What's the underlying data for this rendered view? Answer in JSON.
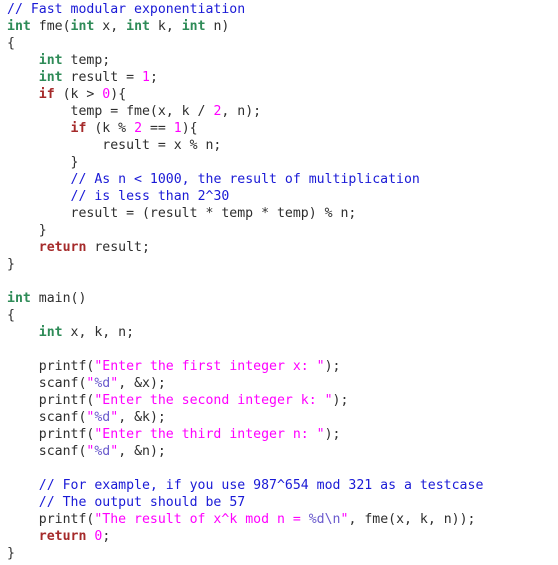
{
  "editor": {
    "language": "C",
    "colors": {
      "comment": "#1a1ad6",
      "type": "#2e8b57",
      "keyword": "#a52a2a",
      "number": "#ff00ff",
      "string": "#ff00ff",
      "specifier": "#6a5acd",
      "text": "#2e2e2e",
      "background": "#ffffff"
    },
    "lines": [
      [
        {
          "t": "cm",
          "v": "// Fast modular exponentiation"
        }
      ],
      [
        {
          "t": "ty",
          "v": "int"
        },
        {
          "t": "tx",
          "v": " fme("
        },
        {
          "t": "ty",
          "v": "int"
        },
        {
          "t": "tx",
          "v": " x, "
        },
        {
          "t": "ty",
          "v": "int"
        },
        {
          "t": "tx",
          "v": " k, "
        },
        {
          "t": "ty",
          "v": "int"
        },
        {
          "t": "tx",
          "v": " n)"
        }
      ],
      [
        {
          "t": "tx",
          "v": "{"
        }
      ],
      [
        {
          "t": "tx",
          "v": "    "
        },
        {
          "t": "ty",
          "v": "int"
        },
        {
          "t": "tx",
          "v": " temp;"
        }
      ],
      [
        {
          "t": "tx",
          "v": "    "
        },
        {
          "t": "ty",
          "v": "int"
        },
        {
          "t": "tx",
          "v": " result = "
        },
        {
          "t": "nu",
          "v": "1"
        },
        {
          "t": "tx",
          "v": ";"
        }
      ],
      [
        {
          "t": "tx",
          "v": "    "
        },
        {
          "t": "kw",
          "v": "if"
        },
        {
          "t": "tx",
          "v": " (k > "
        },
        {
          "t": "nu",
          "v": "0"
        },
        {
          "t": "tx",
          "v": "){"
        }
      ],
      [
        {
          "t": "tx",
          "v": "        temp = fme(x, k / "
        },
        {
          "t": "nu",
          "v": "2"
        },
        {
          "t": "tx",
          "v": ", n);"
        }
      ],
      [
        {
          "t": "tx",
          "v": "        "
        },
        {
          "t": "kw",
          "v": "if"
        },
        {
          "t": "tx",
          "v": " (k % "
        },
        {
          "t": "nu",
          "v": "2"
        },
        {
          "t": "tx",
          "v": " == "
        },
        {
          "t": "nu",
          "v": "1"
        },
        {
          "t": "tx",
          "v": "){"
        }
      ],
      [
        {
          "t": "tx",
          "v": "            result = x % n;"
        }
      ],
      [
        {
          "t": "tx",
          "v": "        }"
        }
      ],
      [
        {
          "t": "tx",
          "v": "        "
        },
        {
          "t": "cm",
          "v": "// As n < 1000, the result of multiplication"
        }
      ],
      [
        {
          "t": "tx",
          "v": "        "
        },
        {
          "t": "cm",
          "v": "// is less than 2^30"
        }
      ],
      [
        {
          "t": "tx",
          "v": "        result = (result * temp * temp) % n;"
        }
      ],
      [
        {
          "t": "tx",
          "v": "    }"
        }
      ],
      [
        {
          "t": "tx",
          "v": "    "
        },
        {
          "t": "kw",
          "v": "return"
        },
        {
          "t": "tx",
          "v": " result;"
        }
      ],
      [
        {
          "t": "tx",
          "v": "}"
        }
      ],
      [
        {
          "t": "tx",
          "v": ""
        }
      ],
      [
        {
          "t": "ty",
          "v": "int"
        },
        {
          "t": "tx",
          "v": " main()"
        }
      ],
      [
        {
          "t": "tx",
          "v": "{"
        }
      ],
      [
        {
          "t": "tx",
          "v": "    "
        },
        {
          "t": "ty",
          "v": "int"
        },
        {
          "t": "tx",
          "v": " x, k, n;"
        }
      ],
      [
        {
          "t": "tx",
          "v": ""
        }
      ],
      [
        {
          "t": "tx",
          "v": "    printf("
        },
        {
          "t": "st",
          "v": "\"Enter the first integer x: \""
        },
        {
          "t": "tx",
          "v": ");"
        }
      ],
      [
        {
          "t": "tx",
          "v": "    scanf("
        },
        {
          "t": "st",
          "v": "\""
        },
        {
          "t": "sp",
          "v": "%d"
        },
        {
          "t": "st",
          "v": "\""
        },
        {
          "t": "tx",
          "v": ", &x);"
        }
      ],
      [
        {
          "t": "tx",
          "v": "    printf("
        },
        {
          "t": "st",
          "v": "\"Enter the second integer k: \""
        },
        {
          "t": "tx",
          "v": ");"
        }
      ],
      [
        {
          "t": "tx",
          "v": "    scanf("
        },
        {
          "t": "st",
          "v": "\""
        },
        {
          "t": "sp",
          "v": "%d"
        },
        {
          "t": "st",
          "v": "\""
        },
        {
          "t": "tx",
          "v": ", &k);"
        }
      ],
      [
        {
          "t": "tx",
          "v": "    printf("
        },
        {
          "t": "st",
          "v": "\"Enter the third integer n: \""
        },
        {
          "t": "tx",
          "v": ");"
        }
      ],
      [
        {
          "t": "tx",
          "v": "    scanf("
        },
        {
          "t": "st",
          "v": "\""
        },
        {
          "t": "sp",
          "v": "%d"
        },
        {
          "t": "st",
          "v": "\""
        },
        {
          "t": "tx",
          "v": ", &n);"
        }
      ],
      [
        {
          "t": "tx",
          "v": ""
        }
      ],
      [
        {
          "t": "tx",
          "v": "    "
        },
        {
          "t": "cm",
          "v": "// For example, if you use 987^654 mod 321 as a testcase"
        }
      ],
      [
        {
          "t": "tx",
          "v": "    "
        },
        {
          "t": "cm",
          "v": "// The output should be 57"
        }
      ],
      [
        {
          "t": "tx",
          "v": "    printf("
        },
        {
          "t": "st",
          "v": "\"The result of x^k mod n = "
        },
        {
          "t": "sp",
          "v": "%d\\n"
        },
        {
          "t": "st",
          "v": "\""
        },
        {
          "t": "tx",
          "v": ", fme(x, k, n));"
        }
      ],
      [
        {
          "t": "tx",
          "v": "    "
        },
        {
          "t": "kw",
          "v": "return"
        },
        {
          "t": "tx",
          "v": " "
        },
        {
          "t": "nu",
          "v": "0"
        },
        {
          "t": "tx",
          "v": ";"
        }
      ],
      [
        {
          "t": "tx",
          "v": "}"
        }
      ]
    ]
  }
}
